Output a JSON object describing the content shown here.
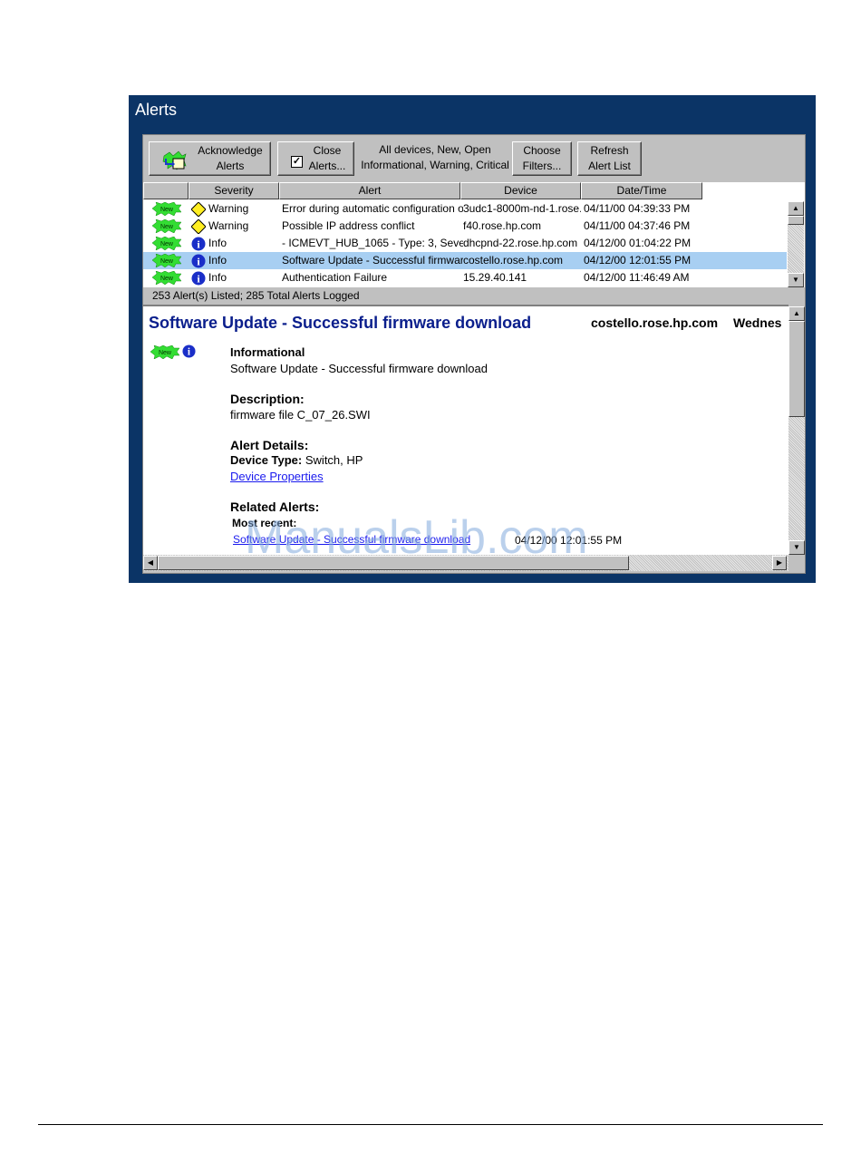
{
  "window": {
    "title": "Alerts"
  },
  "toolbar": {
    "acknowledge_label_1": "Acknowledge",
    "acknowledge_label_2": "Alerts",
    "close_label_1": "Close",
    "close_label_2": "Alerts...",
    "filter_summary_1": "All devices, New, Open",
    "filter_summary_2": "Informational, Warning, Critical",
    "choose_label_1": "Choose",
    "choose_label_2": "Filters...",
    "refresh_label_1": "Refresh",
    "refresh_label_2": "Alert List"
  },
  "list": {
    "columns": [
      "",
      "Severity",
      "Alert",
      "Device",
      "Date/Time"
    ],
    "rows": [
      {
        "badge": "New",
        "severity": "Warning",
        "alert": "Error during automatic configuration of r",
        "device": "3udc1-8000m-nd-1.rose.",
        "datetime": "04/11/00 04:39:33 PM",
        "selected": false
      },
      {
        "badge": "New",
        "severity": "Warning",
        "alert": "Possible IP address conflict",
        "device": "f40.rose.hp.com",
        "datetime": "04/11/00 04:37:46 PM",
        "selected": false
      },
      {
        "badge": "New",
        "severity": "Info",
        "alert": "- ICMEVT_HUB_1065 - Type: 3, Seve",
        "device": "dhcpnd-22.rose.hp.com",
        "datetime": "04/12/00 01:04:22 PM",
        "selected": false
      },
      {
        "badge": "New",
        "severity": "Info",
        "alert": "Software Update - Successful firmwar",
        "device": "costello.rose.hp.com",
        "datetime": "04/12/00 12:01:55 PM",
        "selected": true
      },
      {
        "badge": "New",
        "severity": "Info",
        "alert": "Authentication Failure",
        "device": "15.29.40.141",
        "datetime": "04/12/00 11:46:49 AM",
        "selected": false
      }
    ],
    "status": "253 Alert(s) Listed; 285 Total Alerts Logged"
  },
  "detail": {
    "title": "Software Update - Successful firmware download",
    "device": "costello.rose.hp.com",
    "day": "Wednes",
    "badge": "New",
    "severity_label": "Informational",
    "summary": "Software Update - Successful firmware download",
    "description_heading": "Description:",
    "description": "firmware file C_07_26.SWI",
    "details_heading": "Alert Details:",
    "device_type_label": "Device Type:",
    "device_type_value": "Switch, HP",
    "device_properties_link": "Device Properties",
    "related_heading": "Related Alerts:",
    "most_recent": "Most recent:",
    "related_link": "Software Update - Successful firmware download",
    "related_datetime": "04/12/00 12:01:55 PM"
  },
  "watermark": "ManualsLib.com",
  "colors": {
    "window_bg": "#0b3466",
    "selection": "#a8cff2",
    "title_blue": "#0a1e8c",
    "link": "#1a1aee",
    "new_badge": "#33dd33"
  }
}
